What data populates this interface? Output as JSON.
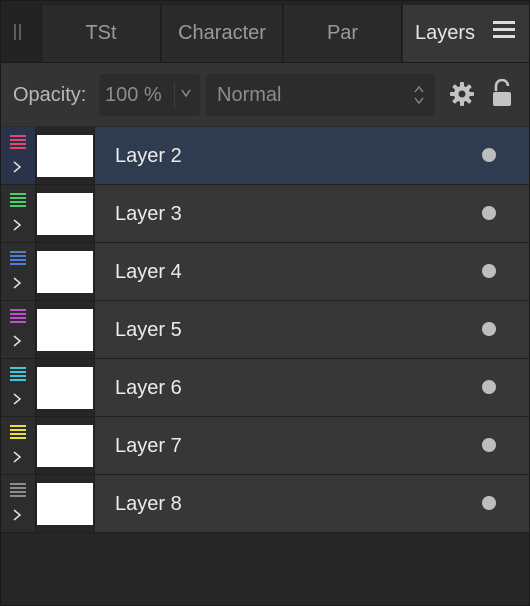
{
  "tabs": {
    "items": [
      {
        "label": "TSt"
      },
      {
        "label": "Character"
      },
      {
        "label": "Par"
      },
      {
        "label": "Layers"
      }
    ],
    "active": "Layers"
  },
  "toolbar": {
    "opacity_label": "Opacity:",
    "opacity_value": "100 %",
    "blend_mode": "Normal"
  },
  "layers": [
    {
      "name": "Layer 2",
      "color": "#e04a6a",
      "selected": true
    },
    {
      "name": "Layer 3",
      "color": "#4ad06a",
      "selected": false
    },
    {
      "name": "Layer 4",
      "color": "#4a7ed8",
      "selected": false
    },
    {
      "name": "Layer 5",
      "color": "#c050c8",
      "selected": false
    },
    {
      "name": "Layer 6",
      "color": "#40c8d8",
      "selected": false
    },
    {
      "name": "Layer 7",
      "color": "#e8e040",
      "selected": false
    },
    {
      "name": "Layer 8",
      "color": "#8c8c8c",
      "selected": false
    }
  ]
}
